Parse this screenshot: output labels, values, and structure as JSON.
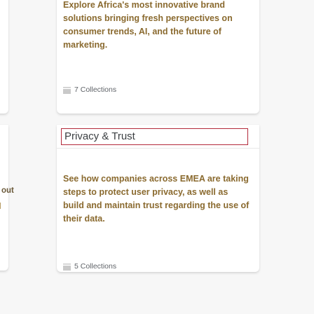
{
  "cards": [
    {
      "title": "",
      "description": "Explore Africa's most innovative brand solutions bringing fresh perspectives on consumer trends, AI, and the future of marketing.",
      "collections": "7 Collections"
    },
    {
      "title": "Privacy & Trust",
      "description": "See how companies across EMEA are taking steps to protect user privacy, as well as build and maintain trust regarding the use of their data.",
      "collections": "5 Collections"
    }
  ],
  "left_card": {
    "partial_text": "out"
  },
  "icons": {
    "collections": "collections-stack-icon"
  }
}
